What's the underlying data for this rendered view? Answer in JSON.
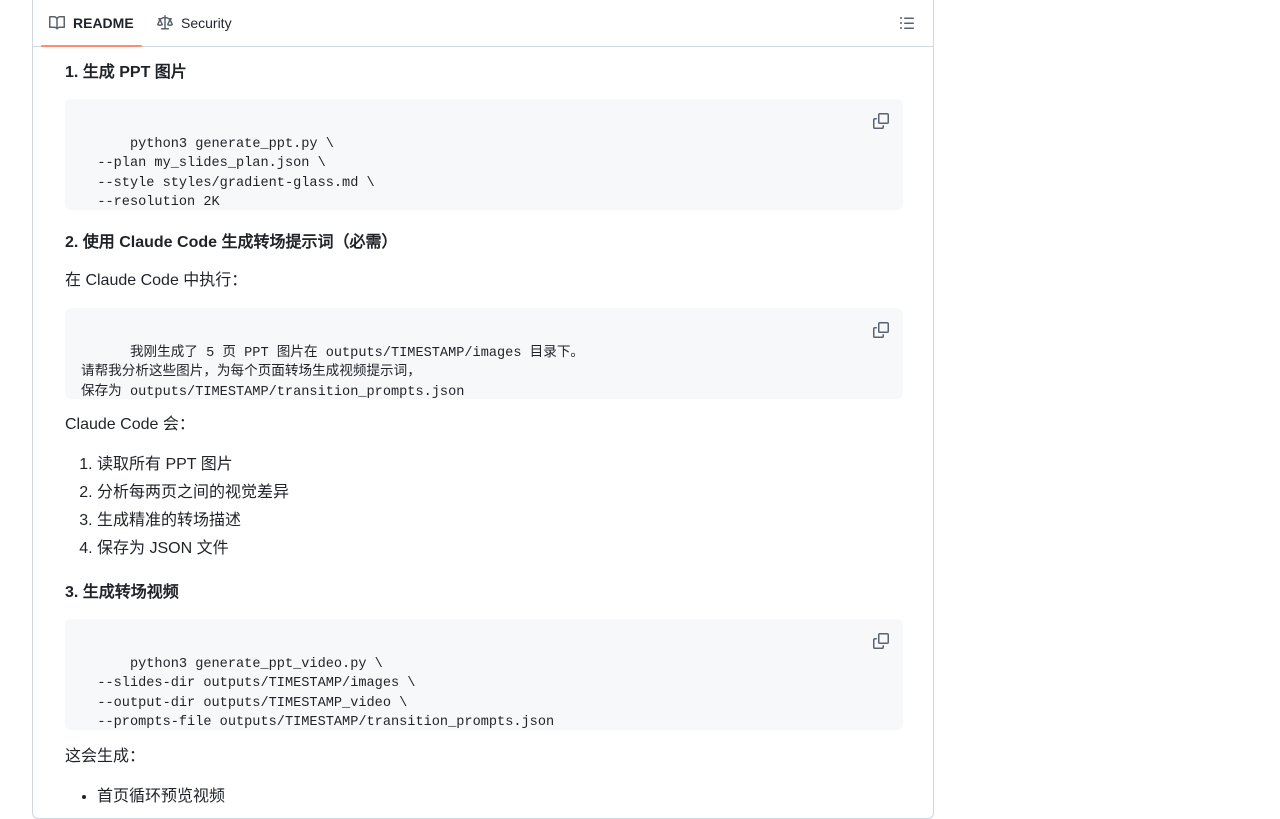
{
  "tabs": {
    "readme": "README",
    "security": "Security"
  },
  "sections": {
    "s1": {
      "heading": "1. 生成 PPT 图片",
      "code": "python3 generate_ppt.py \\\n  --plan my_slides_plan.json \\\n  --style styles/gradient-glass.md \\\n  --resolution 2K"
    },
    "s2": {
      "heading": "2. 使用 Claude Code 生成转场提示词（必需）",
      "intro": "在 Claude Code 中执行：",
      "code": "我刚生成了 5 页 PPT 图片在 outputs/TIMESTAMP/images 目录下。\n请帮我分析这些图片，为每个页面转场生成视频提示词，\n保存为 outputs/TIMESTAMP/transition_prompts.json",
      "after": "Claude Code 会：",
      "steps": [
        "读取所有 PPT 图片",
        "分析每两页之间的视觉差异",
        "生成精准的转场描述",
        "保存为 JSON 文件"
      ]
    },
    "s3": {
      "heading": "3. 生成转场视频",
      "code": "python3 generate_ppt_video.py \\\n  --slides-dir outputs/TIMESTAMP/images \\\n  --output-dir outputs/TIMESTAMP_video \\\n  --prompts-file outputs/TIMESTAMP/transition_prompts.json",
      "after": "这会生成：",
      "bullets": [
        "首页循环预览视频"
      ]
    }
  },
  "icons": {
    "readme": "book-icon",
    "security": "law-scale-icon",
    "outline": "list-unordered-icon",
    "copy": "copy-icon"
  },
  "colors": {
    "active_tab_underline": "#fd8c73",
    "code_background": "#f6f8fa",
    "border": "#d0d7de"
  }
}
